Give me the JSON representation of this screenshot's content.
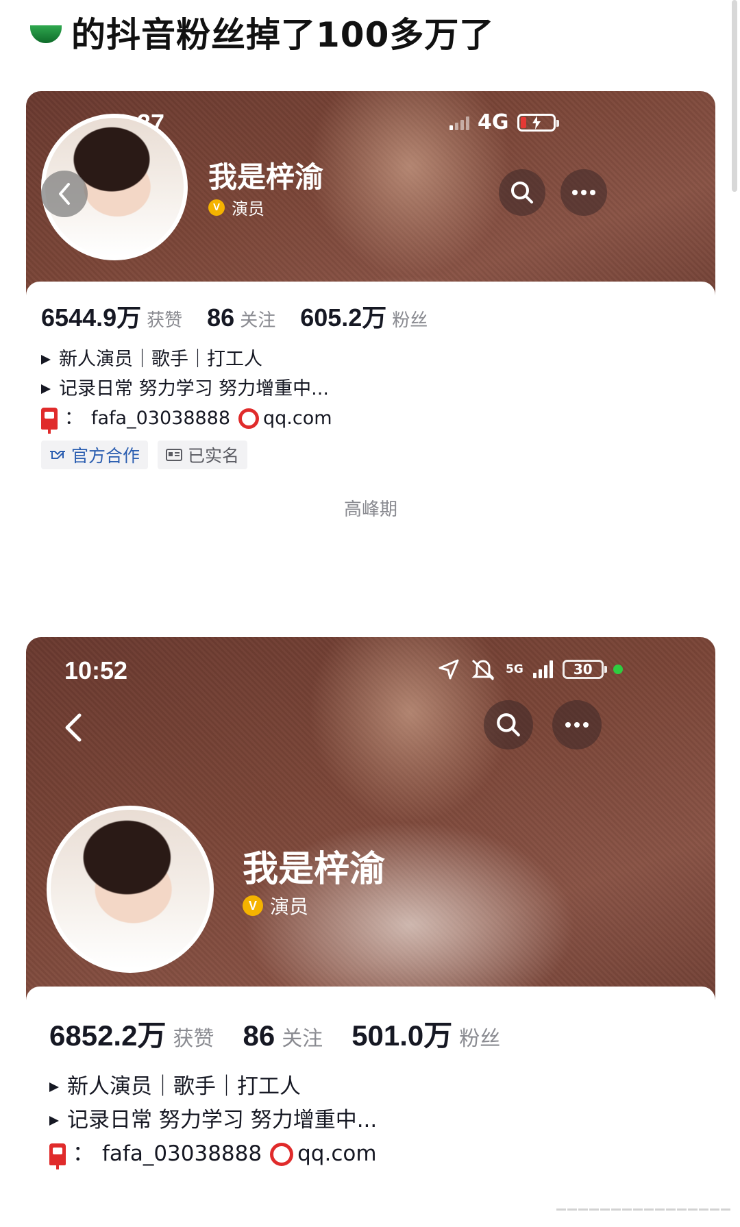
{
  "post": {
    "title": "的抖音粉丝掉了100多万了"
  },
  "screenshot1": {
    "status": {
      "time": "23:37",
      "network": "4G"
    },
    "profile": {
      "name": "我是梓渝",
      "role": "演员"
    },
    "stats": {
      "likes_value": "6544.9万",
      "likes_label": "获赞",
      "following_value": "86",
      "following_label": "关注",
      "followers_value": "605.2万",
      "followers_label": "粉丝"
    },
    "bio": {
      "line1": "新人演员｜歌手｜打工人",
      "line2": "记录日常 努力学习 努力增重中...",
      "email_prefix": "fafa_03038888",
      "email_suffix": "qq.com"
    },
    "tags": {
      "official": "官方合作",
      "verified": "已实名"
    },
    "caption": "高峰期"
  },
  "screenshot2": {
    "status": {
      "time": "10:52",
      "network": "5G",
      "battery": "30"
    },
    "profile": {
      "name": "我是梓渝",
      "role": "演员"
    },
    "stats": {
      "likes_value": "6852.2万",
      "likes_label": "获赞",
      "following_value": "86",
      "following_label": "关注",
      "followers_value": "501.0万",
      "followers_label": "粉丝"
    },
    "bio": {
      "line1": "新人演员｜歌手｜打工人",
      "line2": "记录日常 努力学习 努力增重中...",
      "email_prefix": "fafa_03038888",
      "email_suffix": "qq.com"
    }
  },
  "icons": [
    "heart-icon",
    "back-icon",
    "search-icon",
    "more-icon",
    "signal-icon",
    "battery-icon",
    "location-icon",
    "mute-icon",
    "verified-v-icon",
    "mailbox-icon",
    "handshake-icon",
    "id-card-icon"
  ]
}
